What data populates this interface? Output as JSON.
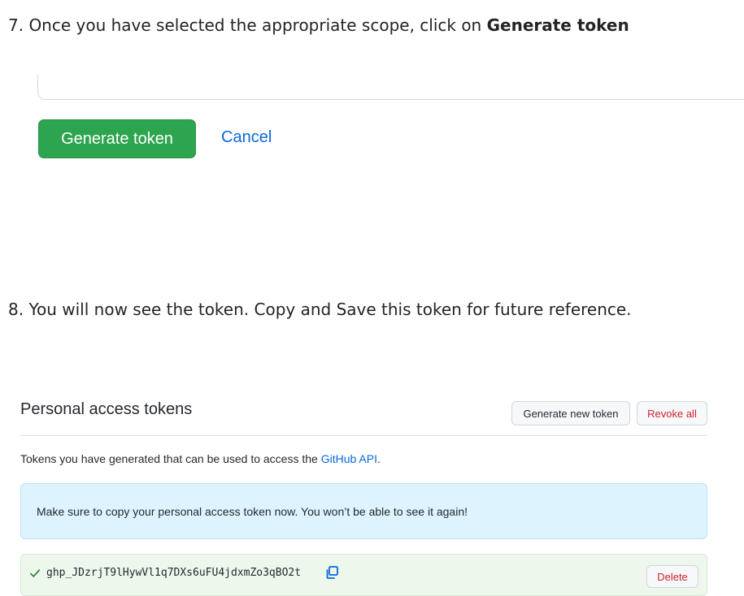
{
  "step7": {
    "text": "7. Once you have selected the appropriate scope, click on ",
    "bold": "Generate token"
  },
  "form": {
    "generate_label": "Generate token",
    "cancel_label": "Cancel"
  },
  "step8": {
    "text": "8. You will now see the token. Copy and Save this token for future reference."
  },
  "tokens": {
    "title": "Personal access tokens",
    "generate_new_label": "Generate new token",
    "revoke_all_label": "Revoke all",
    "description_prefix": "Tokens you have generated that can be used to access the ",
    "description_link": "GitHub API",
    "description_suffix": ".",
    "flash_message": "Make sure to copy your personal access token now. You won’t be able to see it again!",
    "token_value": "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",
    "delete_label": "Delete"
  },
  "icons": {
    "check": "check-icon",
    "copy": "copy-icon"
  },
  "colors": {
    "primary_button": "#2da44e",
    "link": "#0969da",
    "flash_bg": "#ddf4ff",
    "token_row_bg": "#eef7ec",
    "danger": "#cf222e"
  }
}
